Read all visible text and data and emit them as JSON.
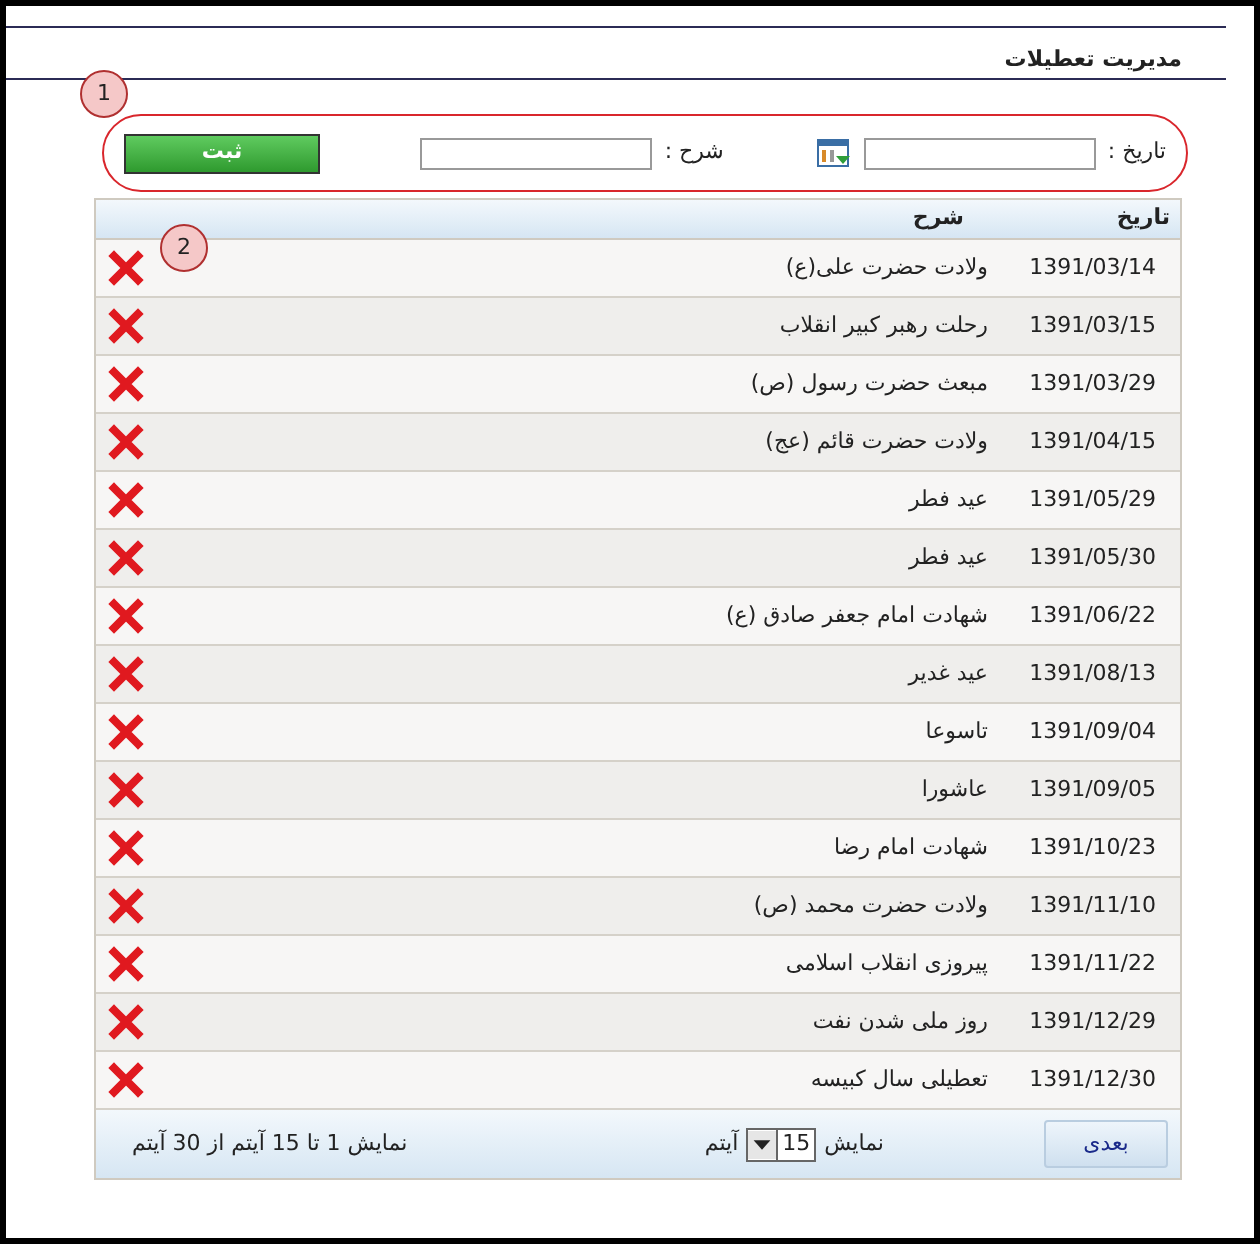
{
  "page_title": "مدیریت تعطیلات",
  "callouts": [
    "1",
    "2"
  ],
  "form": {
    "date_label": "تاریخ :",
    "description_label": "شرح :",
    "submit": "ثبت"
  },
  "table": {
    "columns": [
      "تاریخ",
      "شرح"
    ],
    "rows": [
      {
        "date": "1391/03/14",
        "description": "ولادت حضرت علی(ع)"
      },
      {
        "date": "1391/03/15",
        "description": "رحلت رهبر کبیر انقلاب"
      },
      {
        "date": "1391/03/29",
        "description": "مبعث حضرت رسول (ص)"
      },
      {
        "date": "1391/04/15",
        "description": "ولادت حضرت قائم (عج)"
      },
      {
        "date": "1391/05/29",
        "description": "عید فطر"
      },
      {
        "date": "1391/05/30",
        "description": "عید فطر"
      },
      {
        "date": "1391/06/22",
        "description": "شهادت امام جعفر صادق (ع)"
      },
      {
        "date": "1391/08/13",
        "description": "عید غدیر"
      },
      {
        "date": "1391/09/04",
        "description": "تاسوعا"
      },
      {
        "date": "1391/09/05",
        "description": "عاشورا"
      },
      {
        "date": "1391/10/23",
        "description": "شهادت امام رضا"
      },
      {
        "date": "1391/11/10",
        "description": "ولادت حضرت محمد (ص)"
      },
      {
        "date": "1391/11/22",
        "description": "پیروزی انقلاب اسلامی"
      },
      {
        "date": "1391/12/29",
        "description": "روز ملی شدن نفت"
      },
      {
        "date": "1391/12/30",
        "description": "تعطیلی سال کبیسه"
      }
    ]
  },
  "pager": {
    "next": "بعدی",
    "show_label": "نمایش",
    "page_size": "15",
    "items_label": "آیتم",
    "summary": "نمایش 1 تا 15 آیتم از 30 آیتم"
  }
}
